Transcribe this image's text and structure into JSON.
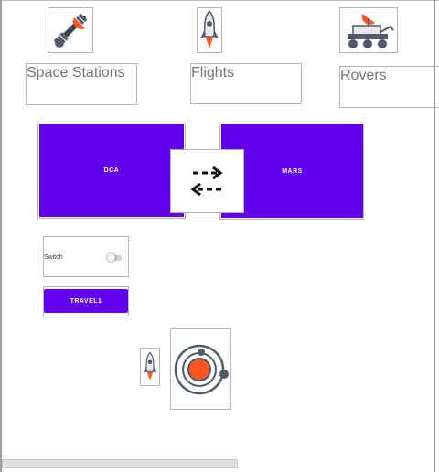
{
  "nav": {
    "space_stations": {
      "label": "Space Stations",
      "icon": "satellite-icon"
    },
    "flights": {
      "label": "Flights",
      "icon": "rocket-icon"
    },
    "rovers": {
      "label": "Rovers",
      "icon": "rover-icon"
    }
  },
  "route": {
    "origin": "DCA",
    "destination": "MARS",
    "swap_icon": "swap-arrows-icon"
  },
  "switch": {
    "label": "Switch",
    "checked": false
  },
  "travel_button": {
    "label": "TRAVEL1"
  },
  "bottom_icons": {
    "small": "rocket-icon",
    "large": "planet-orbit-icon"
  },
  "colors": {
    "accent": "#6200ee",
    "orange": "#ff5722",
    "icon_gray": "#505a69"
  }
}
